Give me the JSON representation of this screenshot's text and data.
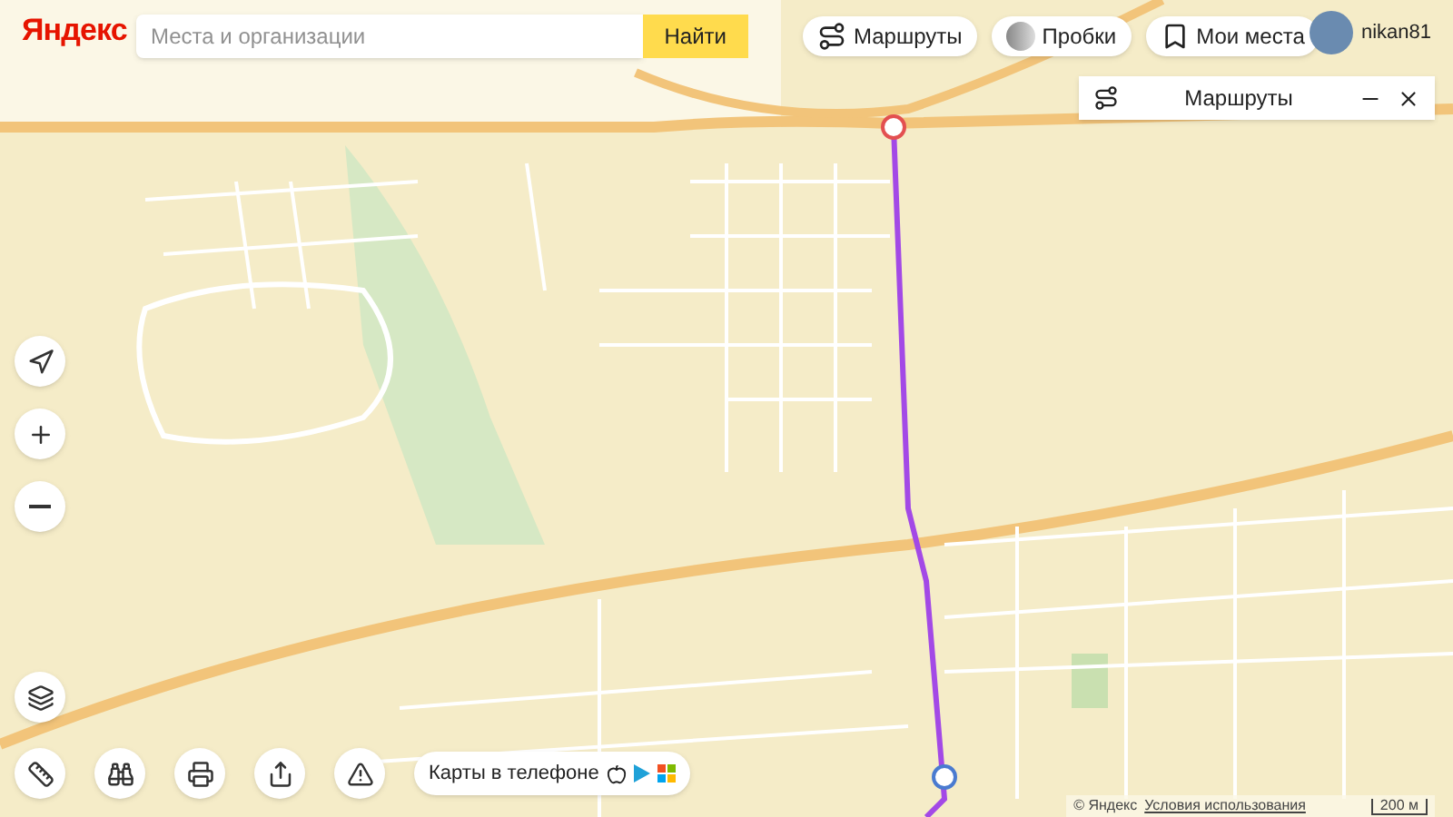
{
  "logo": "Яндекс",
  "search": {
    "placeholder": "Места и организации",
    "button": "Найти"
  },
  "nav_buttons": [
    {
      "kind": "routes",
      "label": "Маршруты"
    },
    {
      "kind": "traffic",
      "label": "Пробки"
    },
    {
      "kind": "bookmark",
      "label": "Мои места"
    }
  ],
  "user": {
    "name": "nikan81"
  },
  "routes_panel": {
    "title": "Маршруты"
  },
  "map_controls": [
    {
      "kind": "locate"
    },
    {
      "kind": "zoom_in"
    },
    {
      "kind": "zoom_out"
    }
  ],
  "bottom_tools": [
    {
      "kind": "layers"
    },
    {
      "kind": "ruler"
    },
    {
      "kind": "panorama"
    },
    {
      "kind": "print"
    },
    {
      "kind": "share"
    },
    {
      "kind": "report"
    }
  ],
  "app_promo": {
    "label": "Карты в телефоне"
  },
  "footer": {
    "copyright": "© Яндекс",
    "terms": "Условия использования",
    "scale": "200 м"
  }
}
